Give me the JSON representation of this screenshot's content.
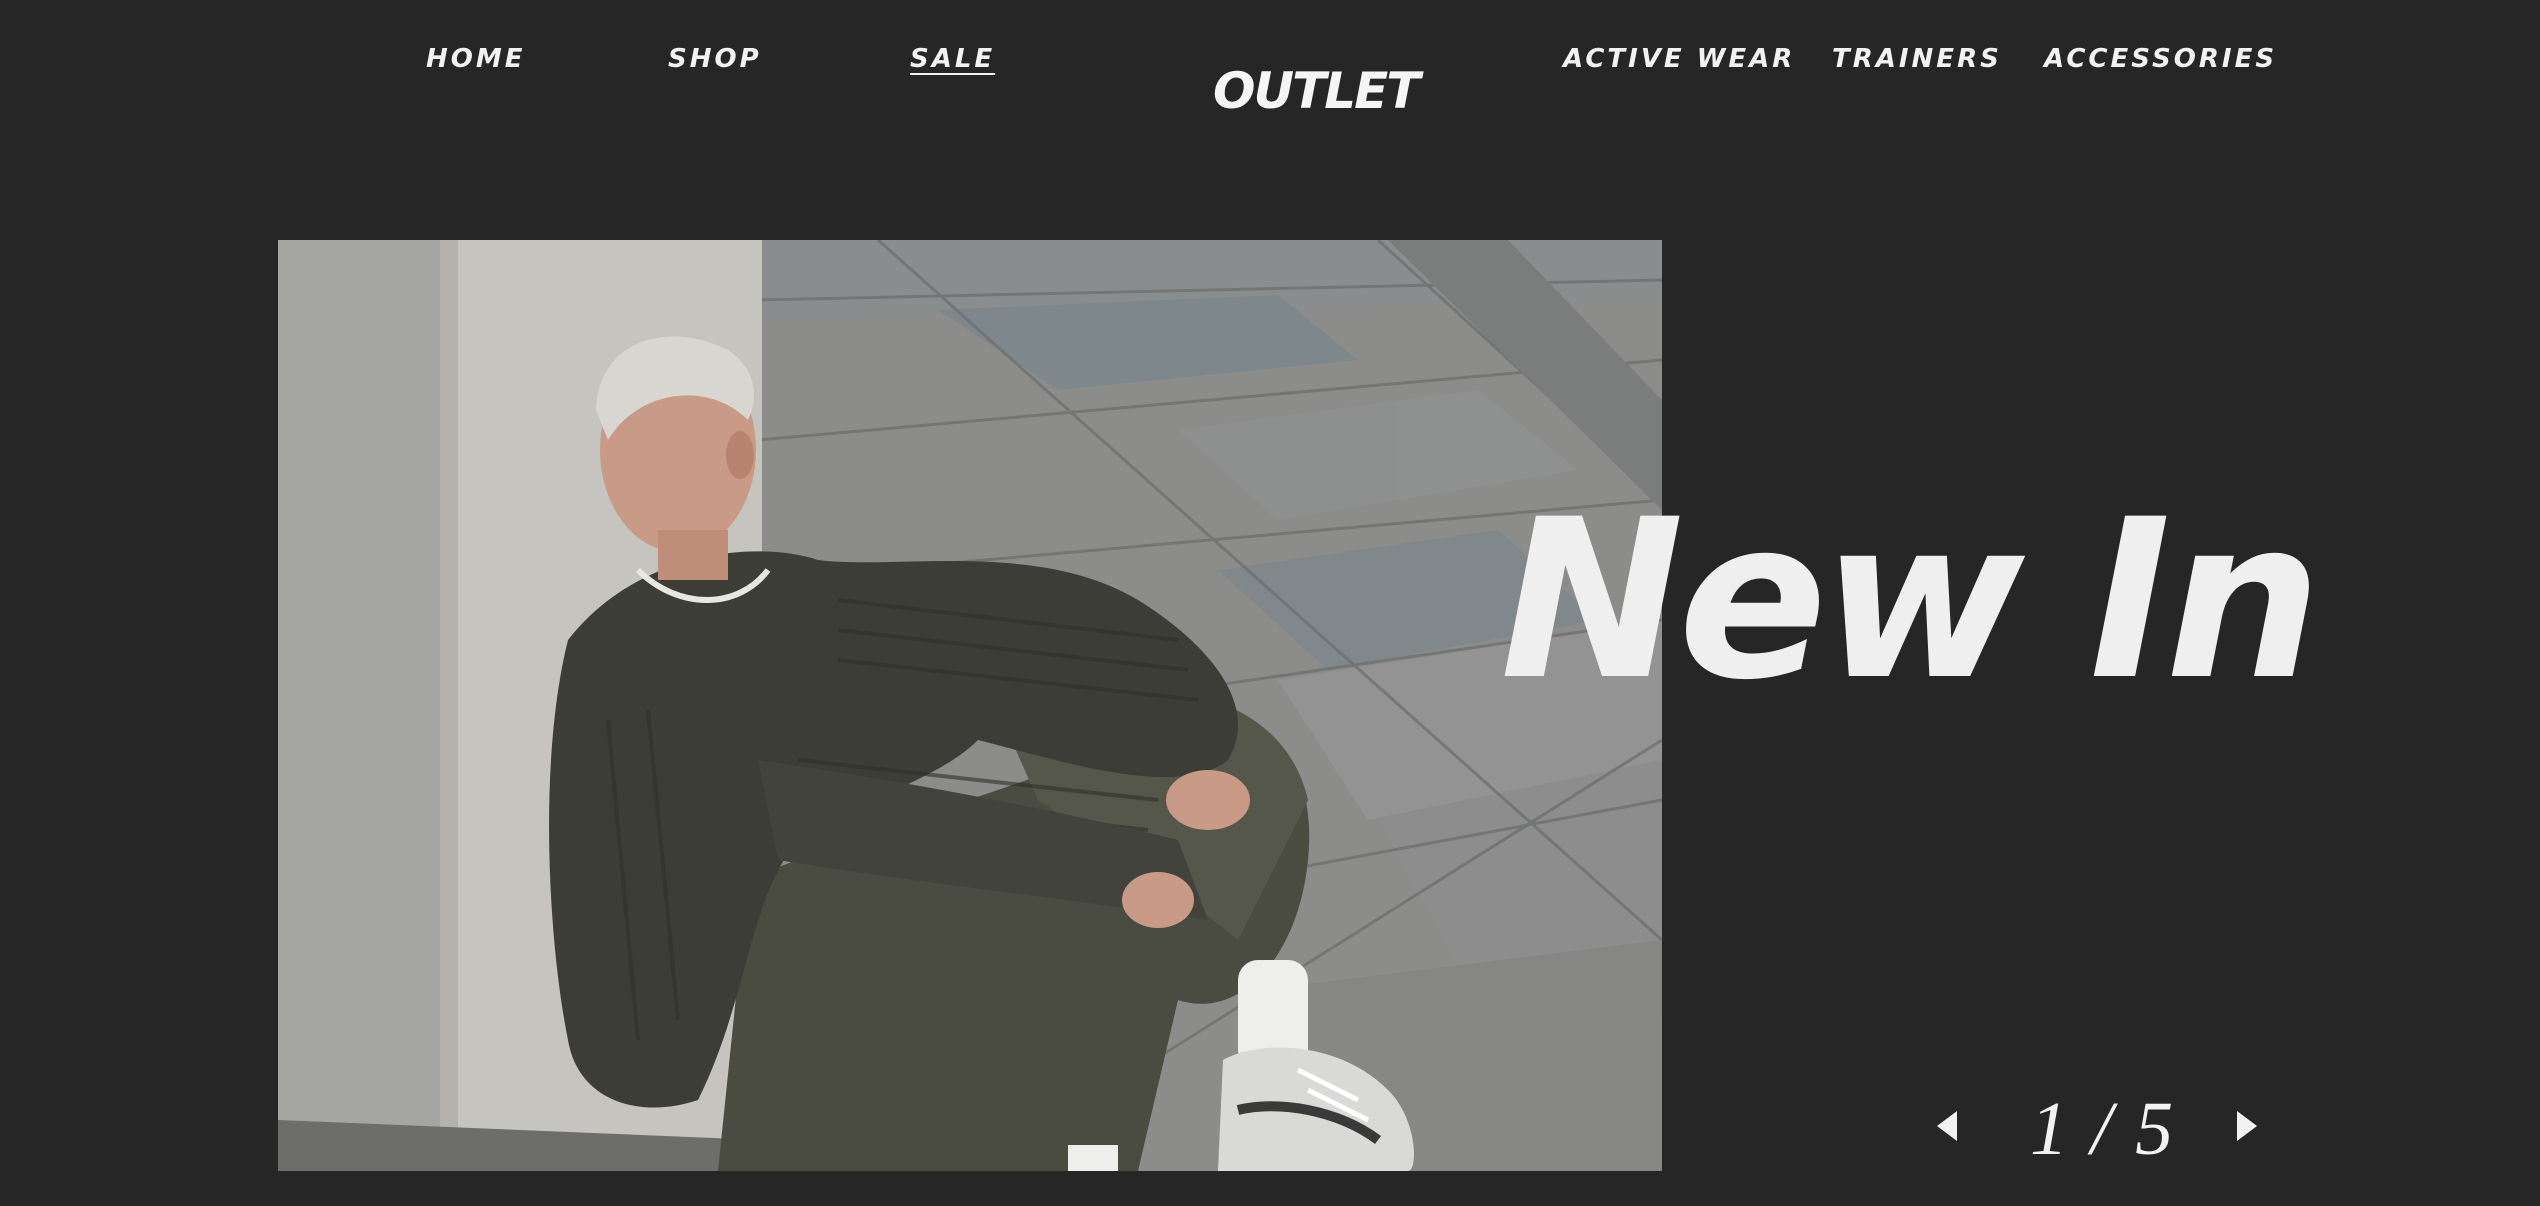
{
  "nav": {
    "left": [
      {
        "label": "HOME"
      },
      {
        "label": "SHOP"
      },
      {
        "label": "SALE"
      }
    ],
    "logo": "OUTLET",
    "right": [
      {
        "label": "ACTIVE WEAR"
      },
      {
        "label": "TRAINERS"
      },
      {
        "label": "ACCESSORIES"
      }
    ]
  },
  "hero": {
    "headline": "New In",
    "photo_subject": "model-sitting-against-concrete-pillar"
  },
  "pager": {
    "text": "1 / 5",
    "prev_icon": "arrow-left-icon",
    "next_icon": "arrow-right-icon"
  },
  "colors": {
    "background": "#262626",
    "text": "#f2f2f2"
  }
}
